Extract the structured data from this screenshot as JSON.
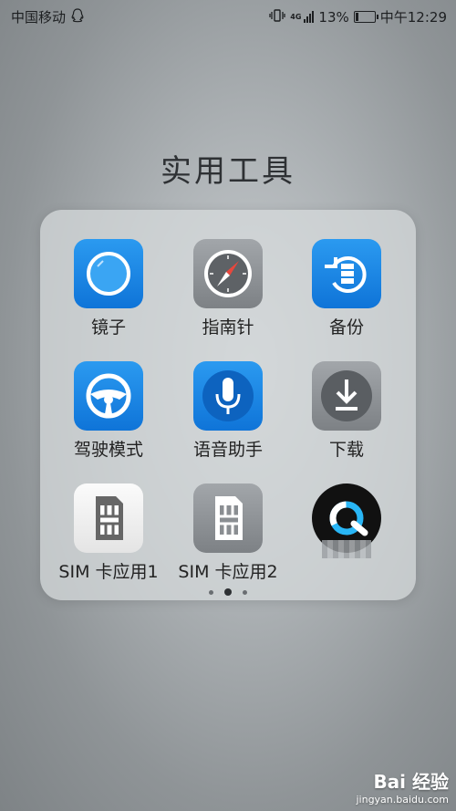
{
  "status_bar": {
    "carrier": "中国移动",
    "network": "4G",
    "battery": "13%",
    "battery_level": 0.13,
    "time": "中午12:29"
  },
  "folder": {
    "title": "实用工具",
    "apps": [
      {
        "label": "镜子",
        "icon": "mirror-icon"
      },
      {
        "label": "指南针",
        "icon": "compass-icon"
      },
      {
        "label": "备份",
        "icon": "backup-icon"
      },
      {
        "label": "驾驶模式",
        "icon": "steering-wheel-icon"
      },
      {
        "label": "语音助手",
        "icon": "microphone-icon"
      },
      {
        "label": "下载",
        "icon": "download-icon"
      },
      {
        "label": "SIM 卡应用1",
        "icon": "sim-card-icon"
      },
      {
        "label": "SIM 卡应用2",
        "icon": "sim-card-icon"
      },
      {
        "label": "",
        "icon": "quik-q-icon"
      }
    ],
    "pages": 3,
    "current_page": 2
  },
  "watermark": {
    "brand": "Bai 经验",
    "url": "jingyan.baidu.com"
  },
  "colors": {
    "accent_blue": "#1783e2",
    "gray_icon": "#8e9296"
  }
}
